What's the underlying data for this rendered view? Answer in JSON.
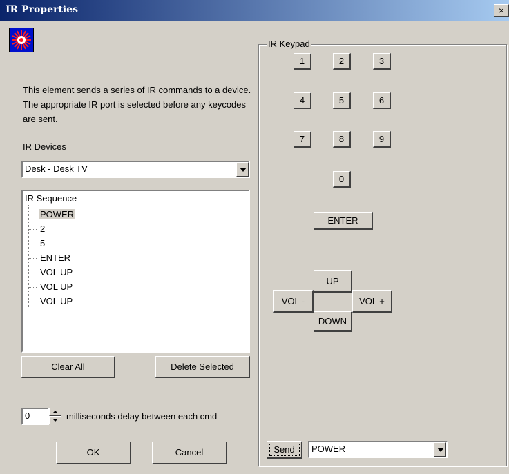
{
  "window": {
    "title": "IR Properties",
    "close_glyph": "×"
  },
  "app_icon": "ir-burst-icon",
  "description": "This element sends a series of IR commands to a device.  The appropriate IR port is selected before any keycodes are sent.",
  "devices": {
    "label": "IR Devices",
    "selected": "Desk - Desk TV"
  },
  "sequence": {
    "root": "IR Sequence",
    "items": [
      "POWER",
      "2",
      "5",
      "ENTER",
      "VOL UP",
      "VOL UP",
      "VOL UP"
    ],
    "selected_index": 0
  },
  "buttons": {
    "clear_all": "Clear All",
    "delete_selected": "Delete Selected",
    "ok": "OK",
    "cancel": "Cancel"
  },
  "delay": {
    "value": "0",
    "label": "milliseconds delay between each cmd"
  },
  "keypad": {
    "label": "IR Keypad",
    "digits": [
      "1",
      "2",
      "3",
      "4",
      "5",
      "6",
      "7",
      "8",
      "9",
      "0"
    ],
    "enter": "ENTER",
    "up": "UP",
    "down": "DOWN",
    "vol_minus": "VOL -",
    "vol_plus": "VOL +",
    "send": "Send",
    "send_selected": "POWER"
  }
}
